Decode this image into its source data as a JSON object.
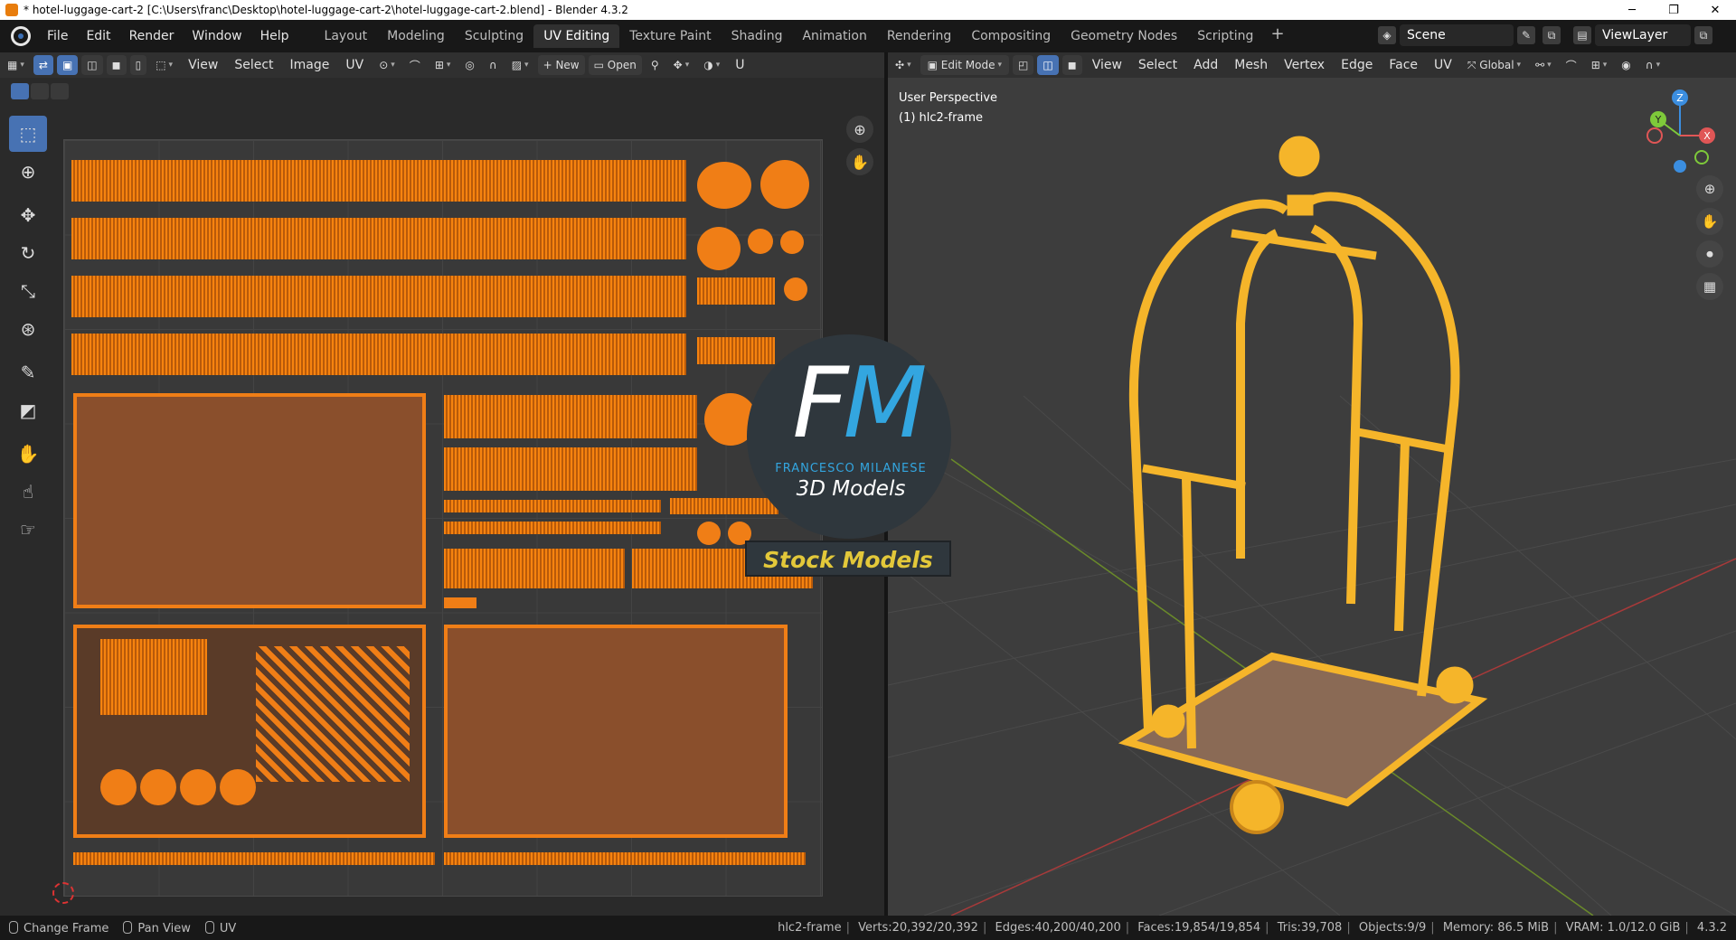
{
  "window": {
    "title": "* hotel-luggage-cart-2 [C:\\Users\\franc\\Desktop\\hotel-luggage-cart-2\\hotel-luggage-cart-2.blend] - Blender 4.3.2",
    "minimize": "─",
    "restore": "❐",
    "close": "✕"
  },
  "menu": [
    "File",
    "Edit",
    "Render",
    "Window",
    "Help"
  ],
  "workspaces": {
    "active": "UV Editing",
    "tabs": [
      "Layout",
      "Modeling",
      "Sculpting",
      "UV Editing",
      "Texture Paint",
      "Shading",
      "Animation",
      "Rendering",
      "Compositing",
      "Geometry Nodes",
      "Scripting"
    ],
    "add": "+"
  },
  "scene": {
    "name": "Scene",
    "view_layer": "ViewLayer"
  },
  "uv_editor": {
    "header": {
      "menus": [
        "View",
        "Select",
        "Image",
        "UV"
      ],
      "new_label": "New",
      "open_label": "Open",
      "truncated": "U"
    },
    "nav_icons": [
      "zoom-icon",
      "hand-icon"
    ]
  },
  "viewport": {
    "header": {
      "mode": "Edit Mode",
      "menus": [
        "View",
        "Select",
        "Add",
        "Mesh",
        "Vertex",
        "Edge",
        "Face",
        "UV"
      ],
      "orientation": "Global"
    },
    "perspective_label": "User Perspective",
    "object_label": "(1) hlc2-frame",
    "gizmo_axes": {
      "x": "X",
      "y": "Y",
      "z": "Z"
    }
  },
  "watermark": {
    "logo_letters_f": "F",
    "logo_letters_m": "M",
    "name": "FRANCESCO MILANESE",
    "subtitle": "3D Models",
    "badge": "Stock Models"
  },
  "statusbar": {
    "hints": [
      "Change Frame",
      "Pan View",
      "UV"
    ],
    "object": "hlc2-frame",
    "verts": "Verts:20,392/20,392",
    "edges": "Edges:40,200/40,200",
    "faces": "Faces:19,854/19,854",
    "tris": "Tris:39,708",
    "objects": "Objects:9/9",
    "memory": "Memory: 86.5 MiB",
    "vram": "VRAM: 1.0/12.0 GiB",
    "version": "4.3.2"
  },
  "colors": {
    "accent": "#4772b3",
    "uv_orange": "#f07e16",
    "mesh_yellow": "#f5b52a",
    "watermark_blue": "#33a6e0",
    "badge_yellow": "#e3c83a"
  }
}
